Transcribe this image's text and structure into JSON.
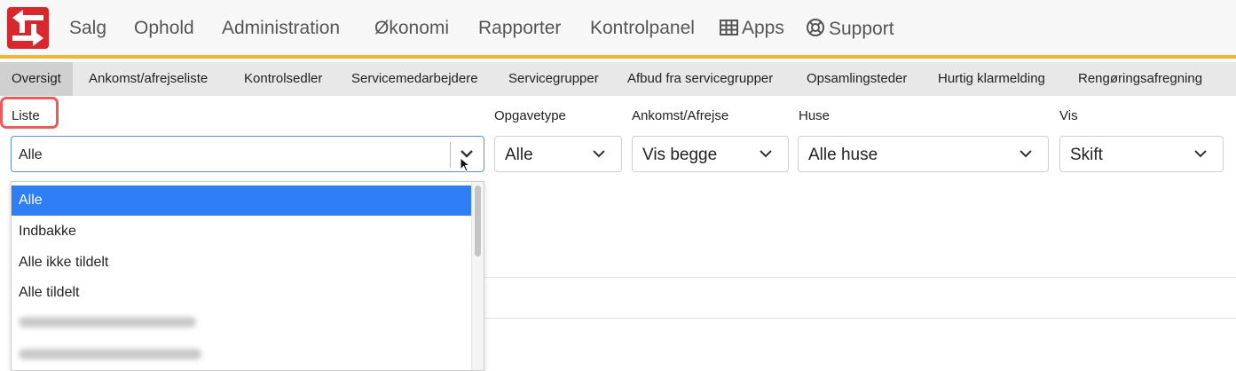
{
  "nav": {
    "items": [
      {
        "label": "Salg"
      },
      {
        "label": "Ophold"
      },
      {
        "label": "Administration"
      },
      {
        "label": "Økonomi"
      },
      {
        "label": "Rapporter"
      },
      {
        "label": "Kontrolpanel"
      },
      {
        "label": "Apps",
        "icon": "grid-icon"
      },
      {
        "label": "Support",
        "icon": "lifebuoy-icon"
      }
    ]
  },
  "subtabs": [
    {
      "label": "Oversigt",
      "active": true
    },
    {
      "label": "Ankomst/afrejseliste"
    },
    {
      "label": "Kontrolsedler"
    },
    {
      "label": "Servicemedarbejdere"
    },
    {
      "label": "Servicegrupper"
    },
    {
      "label": "Afbud fra servicegrupper"
    },
    {
      "label": "Opsamlingsteder"
    },
    {
      "label": "Hurtig klarmelding"
    },
    {
      "label": "Rengøringsafregning"
    }
  ],
  "filters": {
    "liste": {
      "label": "Liste",
      "value": "Alle"
    },
    "opgavetype": {
      "label": "Opgavetype",
      "value": "Alle"
    },
    "ankomst": {
      "label": "Ankomst/Afrejse",
      "value": "Vis begge"
    },
    "huse": {
      "label": "Huse",
      "value": "Alle huse"
    },
    "vis": {
      "label": "Vis",
      "value": "Skift"
    }
  },
  "dropdown": {
    "options": [
      "Alle",
      "Indbakke",
      "Alle ikke tildelt",
      "Alle tildelt"
    ]
  },
  "colors": {
    "accent_bar": "#f0b43c",
    "selected_option": "#2f7ef6",
    "highlight_box": "#f0595a",
    "logo": "#d8282e"
  }
}
